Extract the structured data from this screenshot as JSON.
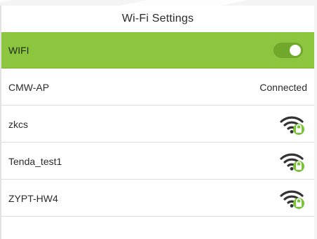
{
  "header": {
    "title": "Wi-Fi Settings"
  },
  "wifi_toggle": {
    "label": "WIFI",
    "enabled": true,
    "accent_color": "#8cc63f"
  },
  "networks": [
    {
      "ssid": "CMW-AP",
      "status": "Connected",
      "icon": null
    },
    {
      "ssid": "zkcs",
      "status": "",
      "icon": "wifi-locked-icon"
    },
    {
      "ssid": "Tenda_test1",
      "status": "",
      "icon": "wifi-locked-icon"
    },
    {
      "ssid": "ZYPT-HW4",
      "status": "",
      "icon": "wifi-locked-icon"
    }
  ]
}
